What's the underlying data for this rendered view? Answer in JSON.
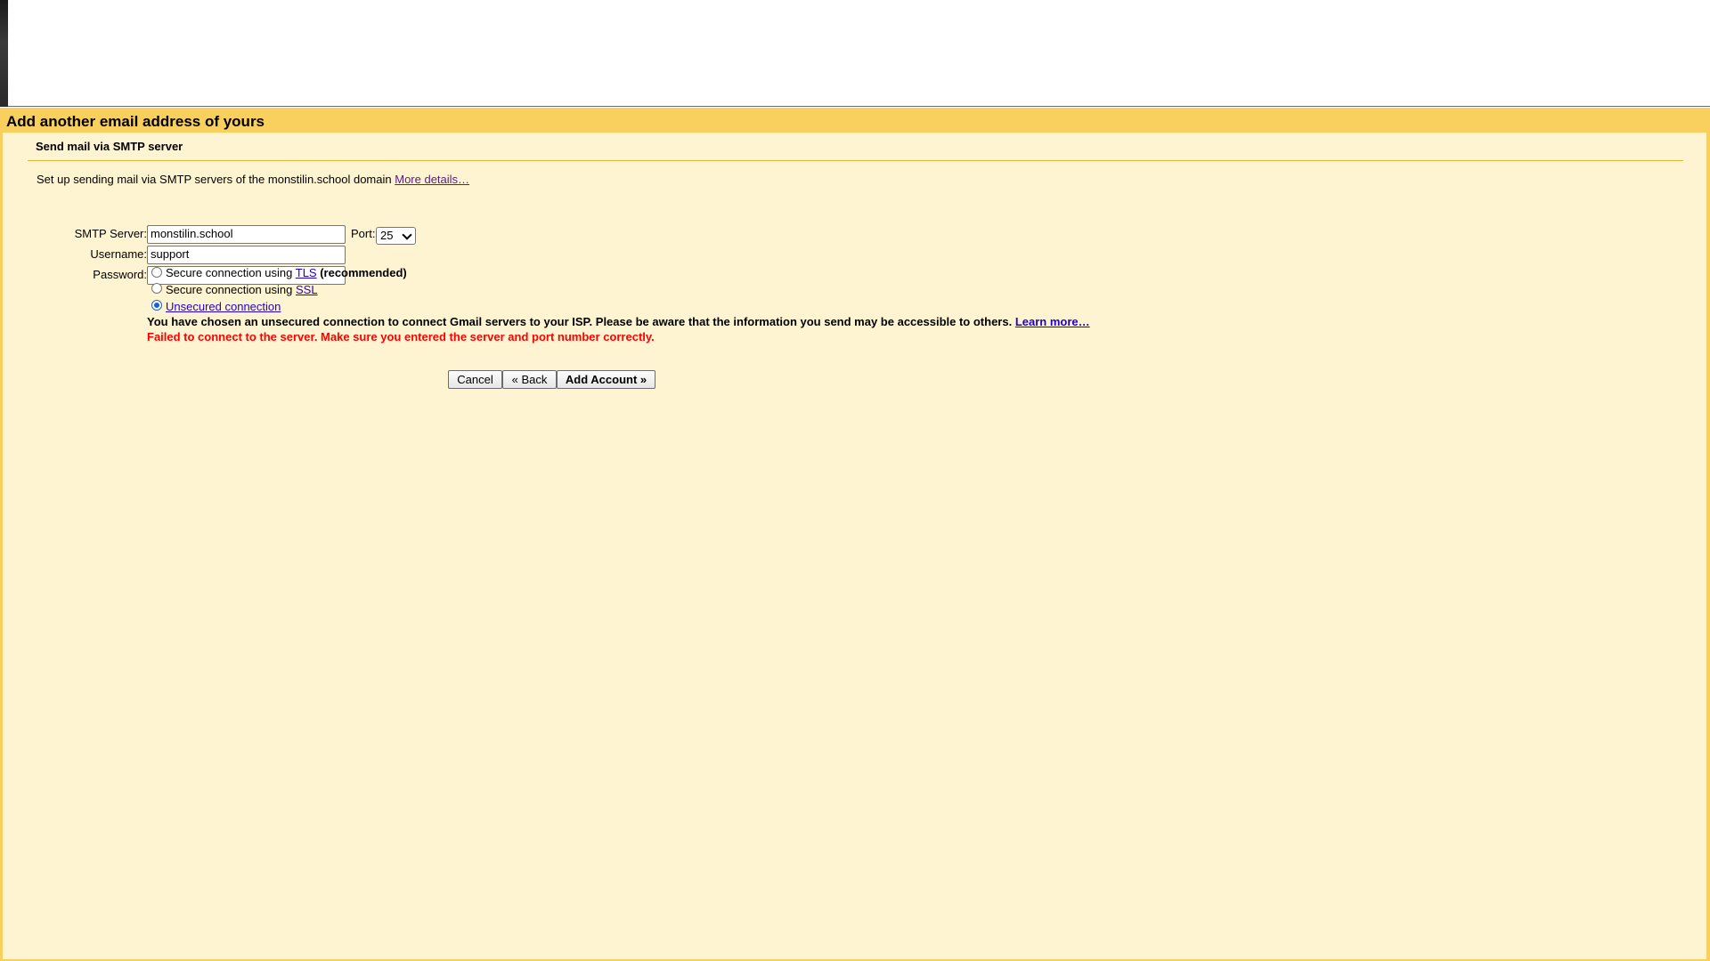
{
  "dialog": {
    "title": "Add another email address of yours",
    "section_title": "Send mail via SMTP server"
  },
  "intro": {
    "text": "Set up sending mail via SMTP servers of the monstilin.school domain ",
    "link": "More details…"
  },
  "form": {
    "smtp_server_label": "SMTP Server:",
    "smtp_server_value": "monstilin.school",
    "port_label": "Port:",
    "port_value": "25",
    "username_label": "Username:",
    "username_value": "support",
    "password_label": "Password:",
    "password_value": ""
  },
  "connection": {
    "tls_prefix": "Secure connection using ",
    "tls_link": "TLS",
    "tls_suffix": " (recommended)",
    "ssl_prefix": "Secure connection using ",
    "ssl_link": "SSL",
    "unsecured_link": "Unsecured connection",
    "selected": "unsecured"
  },
  "messages": {
    "warning": "You have chosen an unsecured connection to connect Gmail servers to your ISP. Please be aware that the information you send may be accessible to others. ",
    "warning_link": "Learn more…",
    "error": "Failed to connect to the server. Make sure you entered the server and port number correctly."
  },
  "buttons": {
    "cancel": "Cancel",
    "back": "« Back",
    "add_account": "Add Account »"
  }
}
